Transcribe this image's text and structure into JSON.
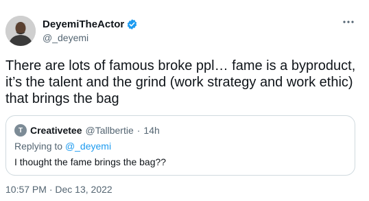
{
  "author": {
    "display_name": "DeyemiTheActor",
    "handle": "@_deyemi",
    "verified_icon": "verified-badge-icon"
  },
  "tweet": {
    "text": "There are lots of famous broke ppl… fame is a byproduct, it’s the talent and the grind (work strategy and work ethic) that brings the bag",
    "time": "10:57 PM",
    "separator": "·",
    "date": "Dec 13, 2022"
  },
  "quoted": {
    "avatar_initial": "T",
    "display_name": "Creativetee",
    "handle": "@Tallbertie",
    "separator": "·",
    "time": "14h",
    "replying_prefix": "Replying to",
    "replying_to": "@_deyemi",
    "text": "I thought the fame brings the bag??"
  },
  "colors": {
    "text": "#0f1419",
    "secondary": "#536471",
    "accent": "#1d9bf0",
    "border": "#cfd9de"
  }
}
